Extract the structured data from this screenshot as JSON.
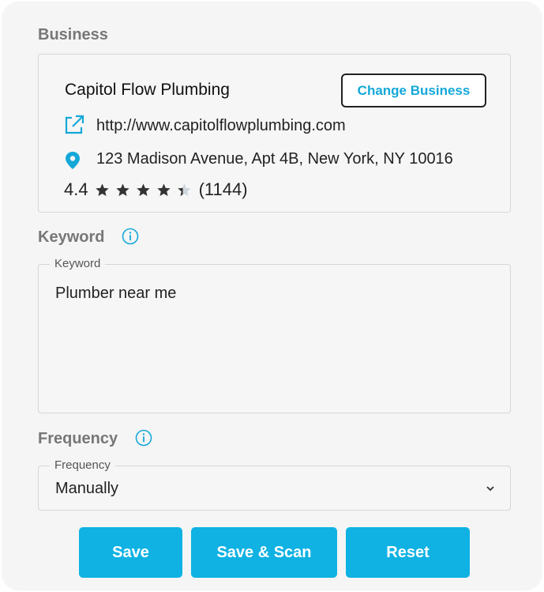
{
  "business": {
    "section_label": "Business",
    "name": "Capitol Flow Plumbing",
    "change_button": "Change Business",
    "url": "http://www.capitolflowplumbing.com",
    "address": "123 Madison Avenue, Apt 4B, New York, NY 10016",
    "rating": "4.4",
    "rating_value": 4.4,
    "review_count": "(1144)"
  },
  "keyword": {
    "section_label": "Keyword",
    "field_label": "Keyword",
    "value": "Plumber near me"
  },
  "frequency": {
    "section_label": "Frequency",
    "field_label": "Frequency",
    "value": "Manually"
  },
  "actions": {
    "save": "Save",
    "save_scan": "Save & Scan",
    "reset": "Reset"
  },
  "colors": {
    "accent": "#0fb2e3",
    "link_accent": "#14a8d8",
    "label_gray": "#777777",
    "panel_bg": "#f5f5f5"
  },
  "icons": {
    "info": "info-icon",
    "external_link": "external-link-icon",
    "location": "location-pin-icon",
    "star": "star-icon",
    "dropdown": "chevron-down-icon"
  }
}
